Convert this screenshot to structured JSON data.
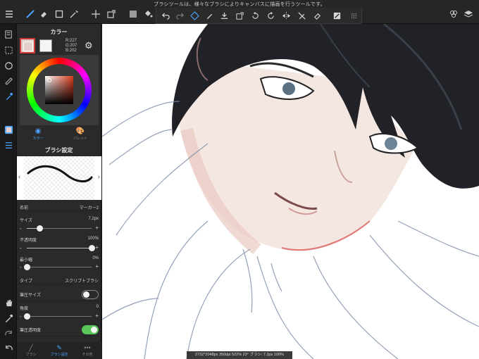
{
  "top_hint": "ブラシツールは、様々なブラシによりキャンバスに描画を行うツールです。",
  "toolbar": {
    "menu_icon": "menu-icon",
    "tools": [
      "brush-icon",
      "eraser-icon",
      "selection-rect-icon",
      "magic-wand-icon",
      "move-icon",
      "transform-icon",
      "fill-rect-icon",
      "bucket-icon"
    ],
    "right_icons": [
      "material-icon",
      "layers-icon"
    ]
  },
  "floating_toolbar": {
    "icons": [
      "undo-icon",
      "redo-icon",
      "snap-icon",
      "pen-icon",
      "paste-icon",
      "transform-icon",
      "rotate-left-icon",
      "rotate-right-icon",
      "flip-icon",
      "no-pen-icon",
      "eraser-icon",
      "fill-icon",
      "grid-icon"
    ]
  },
  "left_tools": {
    "icons": [
      "layers-list-icon",
      "selection-icon",
      "rotate-icon",
      "ruler-icon",
      "eyedropper-icon",
      "color-layer-icon",
      "list-icon",
      "hand-icon",
      "pipette-icon",
      "redo-icon",
      "back-icon"
    ]
  },
  "color_panel": {
    "title": "カラー",
    "main_color": "#e3cfca",
    "sub_color": "#f4f4f4",
    "r_label": "R:227",
    "g_label": "G:207",
    "b_label": "B:202",
    "tabs": [
      {
        "label": "カラー",
        "icon": "color-tab-icon",
        "active": true
      },
      {
        "label": "パレット",
        "icon": "palette-tab-icon",
        "active": false
      }
    ]
  },
  "brush_settings": {
    "title": "ブラシ設定",
    "name_label": "名前",
    "name_value": "マーカー2",
    "size_label": "サイズ",
    "size_value": "7.2px",
    "size_level": 0.2,
    "opacity_label": "不透明度",
    "opacity_value": "100%",
    "opacity_level": 1.0,
    "min_width_label": "最小幅",
    "min_width_value": "0%",
    "min_width_level": 0.0,
    "type_label": "タイプ",
    "type_value": "スクリプトブラシ",
    "pressure_size_label": "筆圧サイズ",
    "pressure_size_on": false,
    "angle_label": "角度",
    "angle_value": "0",
    "angle_level": 0.0,
    "pressure_opacity_label": "筆圧透明度",
    "pressure_opacity_on": true
  },
  "bottom_tabs": [
    {
      "label": "ブラシ",
      "icon": "brush-tab-icon",
      "active": false
    },
    {
      "label": "ブラシ設定",
      "icon": "brush-settings-tab-icon",
      "active": true
    },
    {
      "label": "その他",
      "icon": "more-tab-icon",
      "active": false
    }
  ],
  "status_bar": "2732*2048px 350dpi 522% 23° ブラシ: 7.2px 100%",
  "colors": {
    "accent": "#4aa3ff",
    "toggle_on": "#5ac55a",
    "selected_swatch_border": "#d03a3a"
  }
}
